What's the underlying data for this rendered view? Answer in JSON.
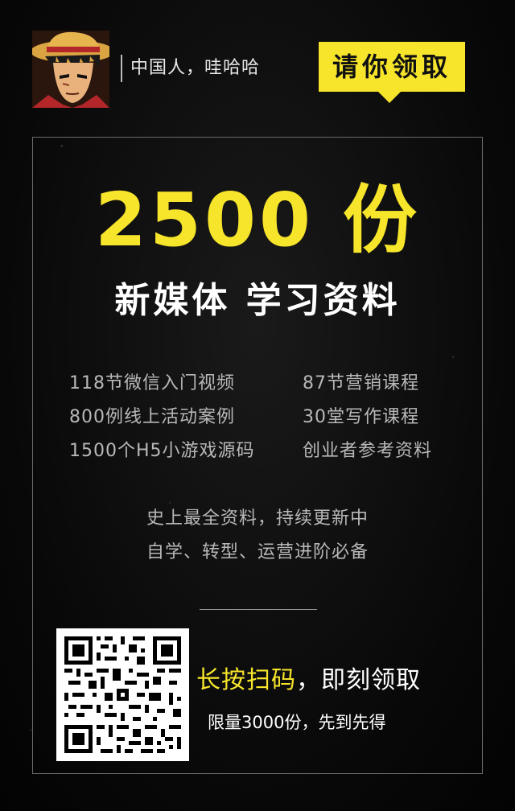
{
  "header": {
    "username": "中国人，哇哈哈",
    "claim_badge": "请你领取"
  },
  "hero": {
    "count": "2500 份",
    "subtitle": "新媒体 学习资料"
  },
  "features": [
    {
      "left": "118节微信入门视频",
      "right": "87节营销课程"
    },
    {
      "left": "800例线上活动案例",
      "right": "30堂写作课程"
    },
    {
      "left": "1500个H5小游戏源码",
      "right": "创业者参考资料"
    }
  ],
  "tagline": {
    "line1": "史上最全资料，持续更新中",
    "line2": "自学、转型、运营进阶必备"
  },
  "cta": {
    "scan_highlight": "长按扫码",
    "scan_rest": "，即刻领取",
    "limit": "限量3000份，先到先得"
  },
  "colors": {
    "accent": "#f7e52b",
    "background": "#050505",
    "text_muted": "#b8b8b8"
  },
  "icons": {
    "avatar": "anime-character-avatar",
    "qr": "qr-code"
  }
}
